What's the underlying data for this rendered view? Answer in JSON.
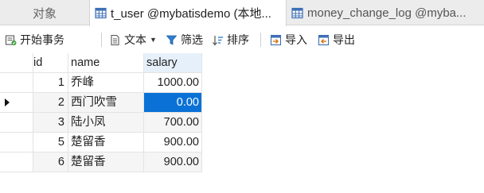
{
  "tabs": {
    "objects": "对象",
    "active": "t_user @mybatisdemo (本地...",
    "other": "money_change_log @myba..."
  },
  "toolbar": {
    "begin_transaction": "开始事务",
    "text": "文本",
    "filter": "筛选",
    "sort": "排序",
    "import": "导入",
    "export": "导出"
  },
  "grid": {
    "columns": [
      "id",
      "name",
      "salary"
    ],
    "rows": [
      {
        "id": "1",
        "name": "乔峰",
        "salary": "1000.00"
      },
      {
        "id": "2",
        "name": "西门吹雪",
        "salary": "0.00"
      },
      {
        "id": "3",
        "name": "陆小凤",
        "salary": "700.00"
      },
      {
        "id": "5",
        "name": "楚留香",
        "salary": "900.00"
      },
      {
        "id": "6",
        "name": "楚留香",
        "salary": "900.00"
      }
    ],
    "current_row": 1,
    "selected_column": "salary"
  },
  "colors": {
    "selection": "#0a72d6",
    "header_highlight": "#e6f0fa",
    "alt_row": "#f5f5f5"
  }
}
